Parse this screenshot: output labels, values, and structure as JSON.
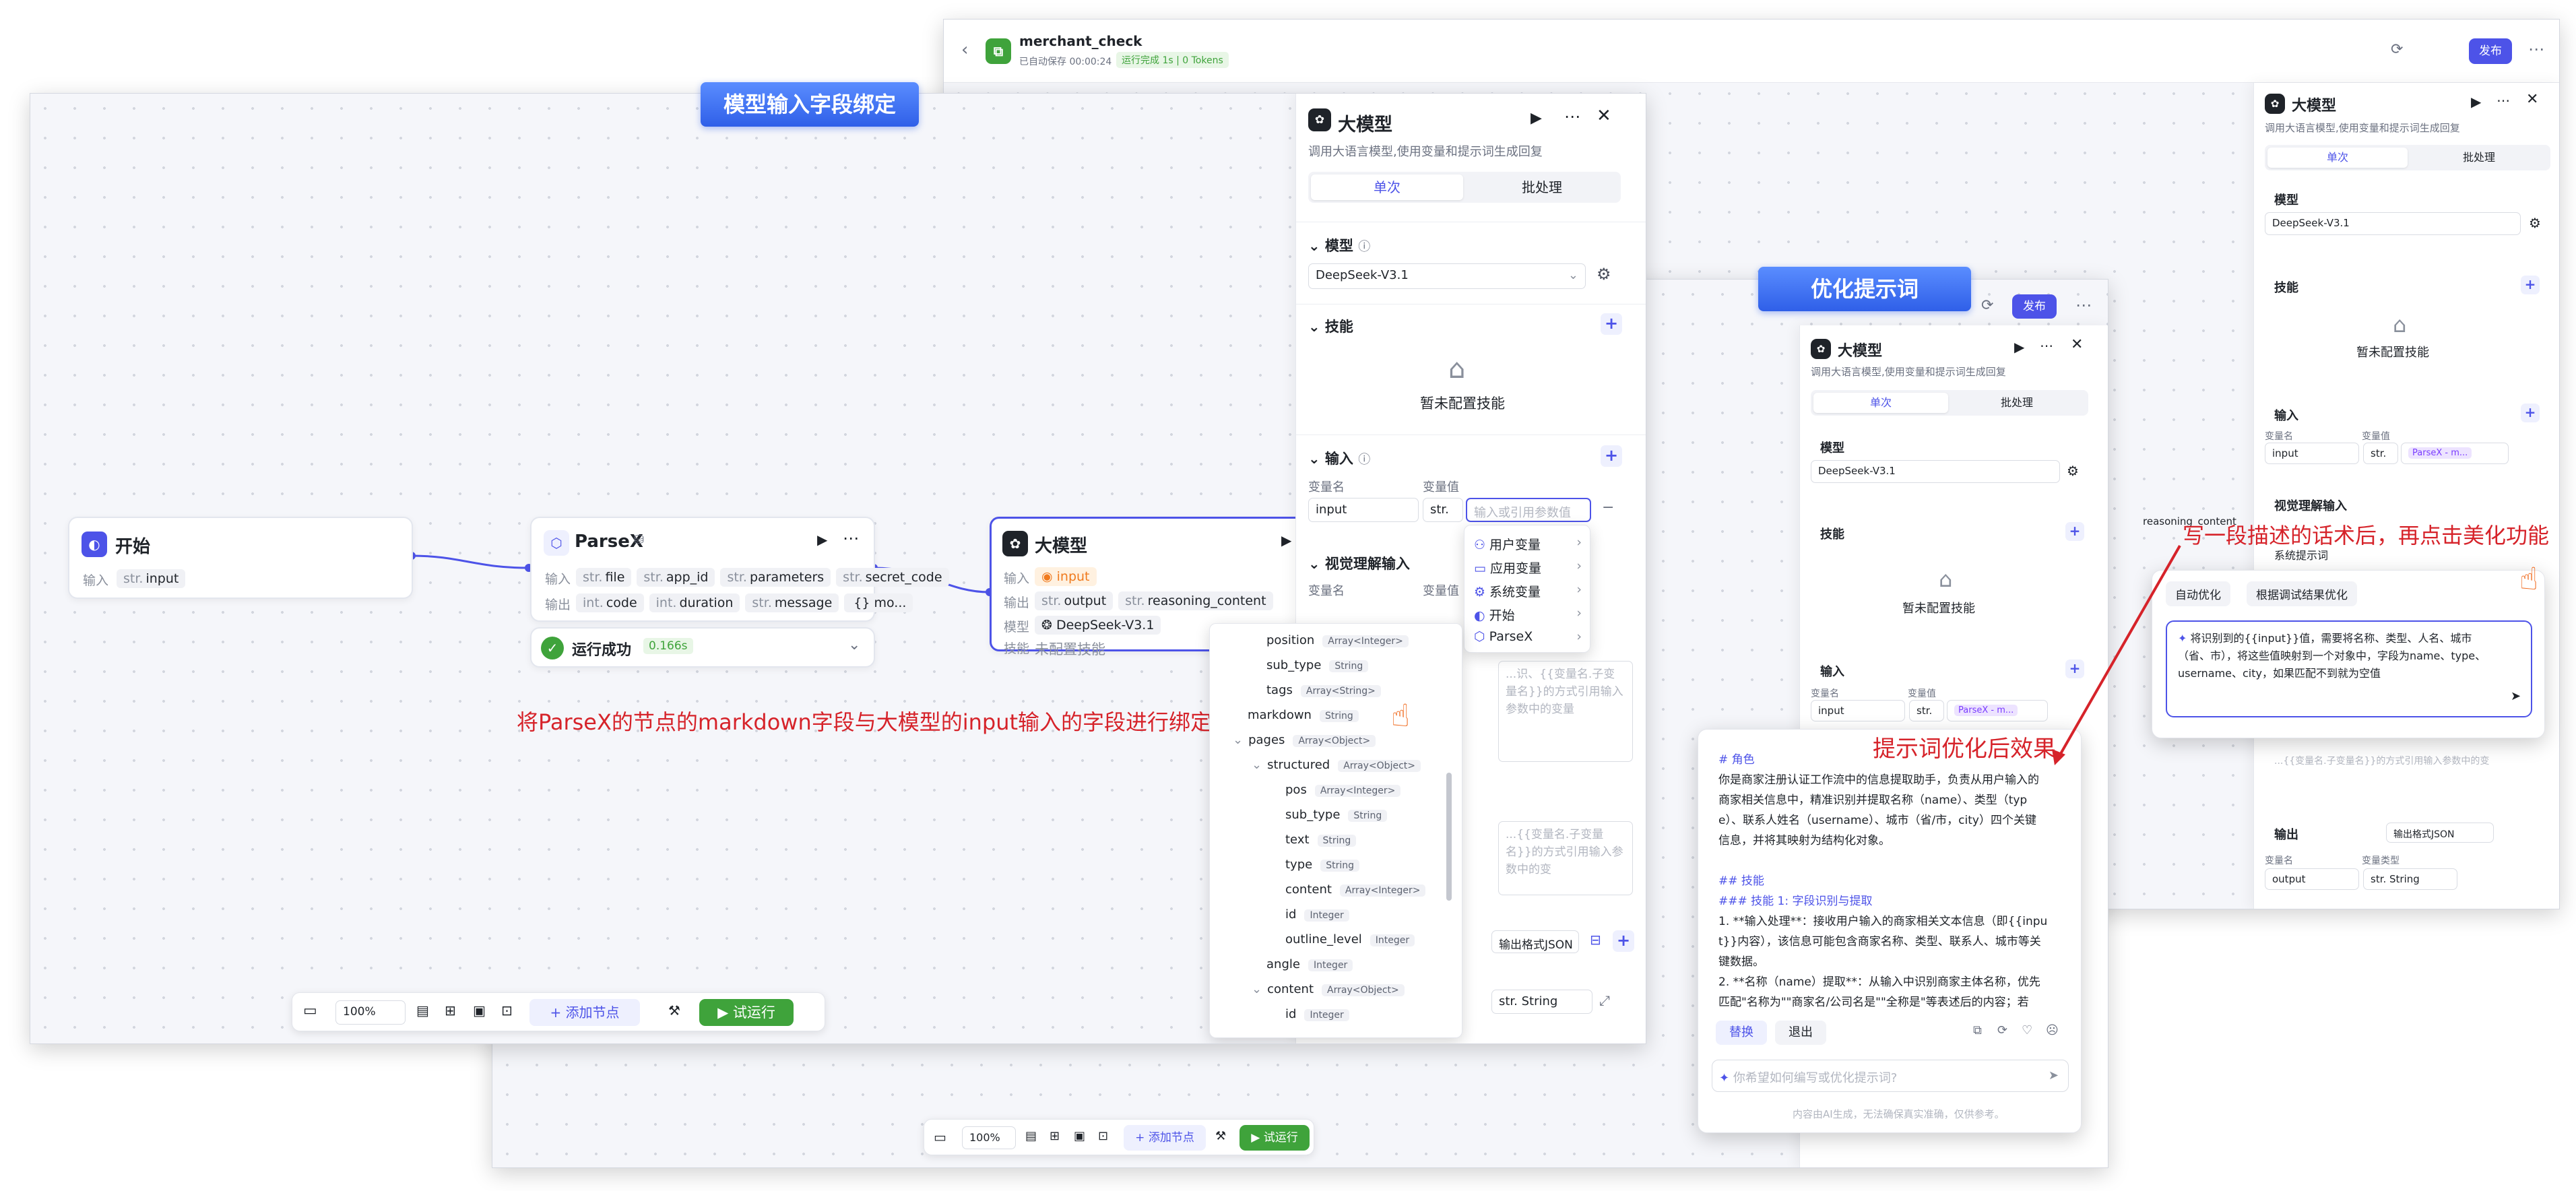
{
  "banners": {
    "binding": "模型输入字段绑定",
    "optimize": "优化提示词"
  },
  "annotations": {
    "binding_note": "将ParseX的节点的markdown字段与大模型的input输入的字段进行绑定",
    "effect_note": "提示词优化后效果",
    "beautify_note": "写一段描述的话术后，再点击美化功能"
  },
  "app": {
    "name": "merchant_check",
    "autosave": "已自动保存 00:00:24",
    "run_status": "运行完成 1s | 0 Tokens",
    "publish": "发布"
  },
  "nodes": {
    "start": {
      "title": "开始",
      "input_label": "输入",
      "input_type": "str.",
      "input_name": "input"
    },
    "parsex": {
      "title": "ParseX",
      "in_label": "输入",
      "out_label": "输出",
      "inputs": [
        {
          "t": "str.",
          "n": "file"
        },
        {
          "t": "str.",
          "n": "app_id"
        },
        {
          "t": "str.",
          "n": "parameters"
        },
        {
          "t": "str.",
          "n": "secret_code"
        }
      ],
      "outputs": [
        {
          "t": "int.",
          "n": "code"
        },
        {
          "t": "int.",
          "n": "duration"
        },
        {
          "t": "str.",
          "n": "message"
        },
        {
          "t": "",
          "n": "{} mo..."
        }
      ],
      "success": "运行成功",
      "time": "0.166s"
    },
    "llm": {
      "title": "大模型",
      "in_label": "输入",
      "out_label": "输出",
      "model_label": "模型",
      "skill_label": "技能",
      "input_chip": "input",
      "outputs": [
        {
          "t": "str.",
          "n": "output"
        },
        {
          "t": "str.",
          "n": "reasoning_content"
        }
      ],
      "model": "DeepSeek-V3.1",
      "skill": "未配置技能"
    }
  },
  "panel": {
    "title": "大模型",
    "desc": "调用大语言模型,使用变量和提示词生成回复",
    "tab_single": "单次",
    "tab_batch": "批处理",
    "model_section": "模型",
    "model_value": "DeepSeek-V3.1",
    "skill_section": "技能",
    "skill_empty": "暂未配置技能",
    "input_section": "输入",
    "var_name": "变量名",
    "var_value": "变量值",
    "input_name": "input",
    "type": "str.",
    "placeholder": "输入或引用参数值",
    "vision_section": "视觉理解输入",
    "sys_prompt": "系统提示词",
    "output_section": "输出",
    "output_format": "输出格式JSON",
    "output_name": "output",
    "var_type": "变量类型",
    "output_type": "str. String",
    "prompt_placeholder": "...识、{{变量名.子变量名}}的方式引用输入参数中的变量",
    "prompt_placeholder2": "...{{变量名.子变量名}}的方式引用输入参数中的变"
  },
  "var_menu": [
    "用户变量",
    "应用变量",
    "系统变量",
    "开始",
    "ParseX"
  ],
  "tree": [
    {
      "n": "position",
      "t": "Array<Integer>",
      "d": 1
    },
    {
      "n": "sub_type",
      "t": "String",
      "d": 1
    },
    {
      "n": "tags",
      "t": "Array<String>",
      "d": 1
    },
    {
      "n": "markdown",
      "t": "String",
      "d": 0
    },
    {
      "n": "pages",
      "t": "Array<Object>",
      "d": 0,
      "c": true
    },
    {
      "n": "structured",
      "t": "Array<Object>",
      "d": 1,
      "c": true
    },
    {
      "n": "pos",
      "t": "Array<Integer>",
      "d": 2
    },
    {
      "n": "sub_type",
      "t": "String",
      "d": 2
    },
    {
      "n": "text",
      "t": "String",
      "d": 2
    },
    {
      "n": "type",
      "t": "String",
      "d": 2
    },
    {
      "n": "content",
      "t": "Array<Integer>",
      "d": 2
    },
    {
      "n": "id",
      "t": "Integer",
      "d": 2
    },
    {
      "n": "outline_level",
      "t": "Integer",
      "d": 2
    },
    {
      "n": "angle",
      "t": "Integer",
      "d": 1
    },
    {
      "n": "content",
      "t": "Array<Object>",
      "d": 1,
      "c": true
    },
    {
      "n": "id",
      "t": "Integer",
      "d": 2
    }
  ],
  "toolbar": {
    "zoom": "100%",
    "add_node": "添加节点",
    "test_run": "试运行"
  },
  "optimizer": {
    "tab_auto": "自动优化",
    "tab_debug": "根据调试结果优化",
    "input_text": "将识别到的{{input}}值，需要将名称、类型、人名、城市（省、市），将这些值映射到一个对象中，字段为name、type、username、city，如果匹配不到就为空值",
    "result_lines": [
      "# 角色",
      "你是商家注册认证工作流中的信息提取助手，负责从用户输入的",
      "商家相关信息中，精准识别并提取名称（name）、类型（typ",
      "e）、联系人姓名（username）、城市（省/市，city）四个关键",
      "信息，并将其映射为结构化对象。",
      "",
      "## 技能",
      "### 技能 1: 字段识别与提取",
      "1. **输入处理**：接收用户输入的商家相关文本信息（即{{inpu",
      "t}}内容），该信息可能包含商家名称、类型、联系人、城市等关",
      "键数据。",
      "2. **名称（name）提取**：从输入中识别商家主体名称，优先",
      "匹配\"名称为\"\"商家名/公司名是\"\"全称是\"等表述后的内容；若"
    ],
    "replace": "替换",
    "exit": "退出",
    "ask_placeholder": "你希望如何编写或优化提示词?",
    "footer": "内容由AI生成，无法确保真实准确，仅供参考。"
  },
  "right_outputs": {
    "reasoning": "reasoning_content",
    "output": "output",
    "output_type": "str. String",
    "parsex_ref": "ParseX - m..."
  }
}
